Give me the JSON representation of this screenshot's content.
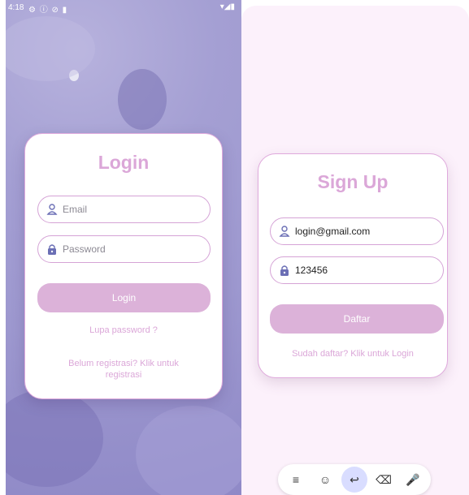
{
  "left_status": {
    "time": "4:18",
    "icons": "⚙ ⓘ ⊘ ▮",
    "right": "▾◢▮"
  },
  "login": {
    "title": "Login",
    "email_placeholder": "Email",
    "password_placeholder": "Password",
    "button": "Login",
    "forgot": "Lupa password ?",
    "register_link": "Belum registrasi? Klik untuk registrasi"
  },
  "signup": {
    "title": "Sign Up",
    "email_value": "login@gmail.com",
    "password_value": "123456",
    "button": "Daftar",
    "login_link": "Sudah daftar? Klik untuk Login"
  },
  "keyboard": {
    "keys": [
      "≡",
      "☺",
      "↩",
      "⌫",
      "🎤"
    ],
    "icons": [
      "menu-icon",
      "emoji-icon",
      "enter-icon",
      "backspace-icon",
      "mic-icon"
    ]
  },
  "colors": {
    "accent": "#dba7d8",
    "button": "#dcb2d9",
    "border": "#d5a3d6",
    "bg_right": "#fcf1fb"
  }
}
